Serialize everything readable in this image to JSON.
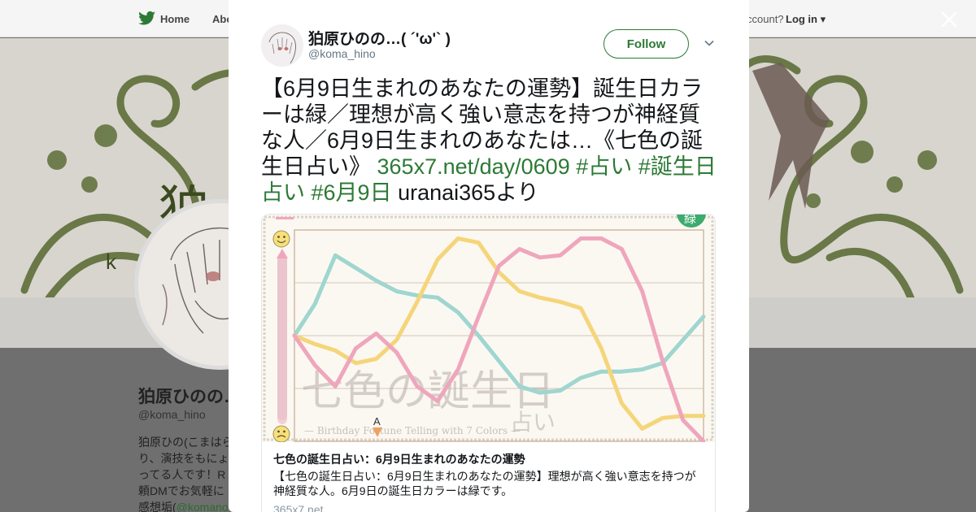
{
  "topbar": {
    "home_label": "Home",
    "about_label": "Abo",
    "account_prompt": "ccount?",
    "login_label": "Log in"
  },
  "profile": {
    "name": "狛原ひのの…",
    "handle": "@koma_hino",
    "bio_lines": [
      "狛原ひの(こまはら",
      "り、演技をもにょ",
      "ってる人です！R",
      "頼DMでお気軽に"
    ],
    "bio_last_prefix": "感想垢(",
    "bio_mention": "@komano",
    "banner_char": "狛",
    "banner_letter": "k"
  },
  "tweet": {
    "author_name": "狛原ひのの…( ´'ω'` )",
    "author_handle": "@koma_hino",
    "follow_label": "Follow",
    "text_plain": "【6月9日生まれのあなたの運勢】誕生日カラーは緑／理想が高く強い意志を持つが神経質な人／6月9日生まれのあなたは…《七色の誕生日占い》 ",
    "link_url": "365x7.net/day/0609",
    "hashtag_1": "#占い",
    "hashtag_2": "#誕生日占い",
    "hashtag_3": "#6月9日",
    "text_suffix": " uranai365より"
  },
  "card": {
    "title": "七色の誕生日占い：6月9日生まれのあなたの運勢",
    "description": "【七色の誕生日占い：6月9日生まれのあなたの運勢】理想が高く強い意志を持つが神経質な人。6月9日の誕生日カラーは緑です。",
    "domain": "365x7.net",
    "image_title_main": "七色の誕生日",
    "image_title_sub": "占い",
    "image_subtitle": "— Birthday Fortune Telling with 7 Colors —",
    "badge_char": "緑",
    "marker_label": "A"
  },
  "chart_data": {
    "type": "line",
    "x": [
      0,
      1,
      2,
      3,
      4,
      5,
      6,
      7,
      8,
      9,
      10,
      11,
      12,
      13,
      14,
      15,
      16,
      17,
      18,
      19,
      20
    ],
    "ylim": [
      0,
      10
    ],
    "series": [
      {
        "color": "#9fd6cf",
        "values": [
          5.0,
          6.5,
          8.8,
          8.2,
          7.6,
          7.1,
          6.9,
          6.8,
          6.1,
          5.0,
          3.8,
          2.6,
          2.3,
          2.4,
          3.0,
          3.3,
          3.3,
          3.4,
          3.7,
          4.8,
          5.9
        ]
      },
      {
        "color": "#f5d57a",
        "values": [
          5.0,
          4.6,
          4.3,
          3.7,
          3.9,
          4.8,
          6.6,
          8.6,
          9.6,
          9.4,
          8.0,
          7.1,
          6.8,
          6.6,
          6.3,
          4.4,
          1.8,
          0.6,
          1.1,
          1.2,
          1.2
        ]
      },
      {
        "color": "#efa6bc",
        "values": [
          5.0,
          3.6,
          2.6,
          4.4,
          5.1,
          4.2,
          2.6,
          1.9,
          3.4,
          5.9,
          8.3,
          9.1,
          8.7,
          8.8,
          9.6,
          9.6,
          9.1,
          7.1,
          3.8,
          1.0,
          0.0
        ]
      }
    ],
    "grid": true
  },
  "colors": {
    "accent_green": "#2c7a35",
    "background_dim": "#6f6f6f"
  }
}
